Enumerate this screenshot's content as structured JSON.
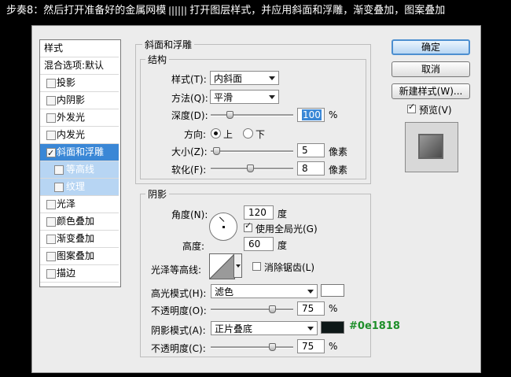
{
  "header": {
    "prefix": "步奏8：然后打开准备好的金属网模",
    "suffix": "打开图层样式，并应用斜面和浮雕，渐变叠加，图案叠加"
  },
  "sidebar": {
    "title": "样式",
    "blending": "混合选项:默认",
    "items": [
      {
        "label": "投影",
        "checked": false
      },
      {
        "label": "内阴影",
        "checked": false
      },
      {
        "label": "外发光",
        "checked": false
      },
      {
        "label": "内发光",
        "checked": false
      },
      {
        "label": "斜面和浮雕",
        "checked": true
      },
      {
        "label": "等高线",
        "checked": false
      },
      {
        "label": "纹理",
        "checked": false
      },
      {
        "label": "光泽",
        "checked": false
      },
      {
        "label": "颜色叠加",
        "checked": false
      },
      {
        "label": "渐变叠加",
        "checked": false
      },
      {
        "label": "图案叠加",
        "checked": false
      },
      {
        "label": "描边",
        "checked": false
      }
    ]
  },
  "bevel": {
    "group_title": "斜面和浮雕",
    "structure_title": "结构",
    "style_label": "样式(T):",
    "style_value": "内斜面",
    "technique_label": "方法(Q):",
    "technique_value": "平滑",
    "depth_label": "深度(D):",
    "depth_value": "100",
    "depth_unit": "%",
    "direction_label": "方向:",
    "dir_up": "上",
    "dir_down": "下",
    "size_label": "大小(Z):",
    "size_value": "5",
    "size_unit": "像素",
    "soften_label": "软化(F):",
    "soften_value": "8",
    "soften_unit": "像素"
  },
  "shading": {
    "title": "阴影",
    "angle_label": "角度(N):",
    "angle_value": "120",
    "angle_unit": "度",
    "global_light": "使用全局光(G)",
    "altitude_label": "高度:",
    "altitude_value": "60",
    "altitude_unit": "度",
    "gloss_label": "光泽等高线:",
    "antialias": "消除锯齿(L)",
    "highlight_label": "高光模式(H):",
    "highlight_value": "滤色",
    "opacity_label": "不透明度(O):",
    "opacity_value": "75",
    "opacity_unit": "%",
    "shadow_label": "阴影模式(A):",
    "shadow_value": "正片叠底",
    "opacity2_label": "不透明度(C):",
    "opacity2_value": "75",
    "opacity2_unit": "%",
    "highlight_color": "#ffffff",
    "shadow_color": "#0e1818",
    "annotation": "#0e1818"
  },
  "buttons": {
    "ok": "确定",
    "cancel": "取消",
    "new_style": "新建样式(W)...",
    "preview": "预览(V)"
  },
  "colors": {
    "accent": "#3a87d6",
    "annotation": "#1e8f2a"
  }
}
